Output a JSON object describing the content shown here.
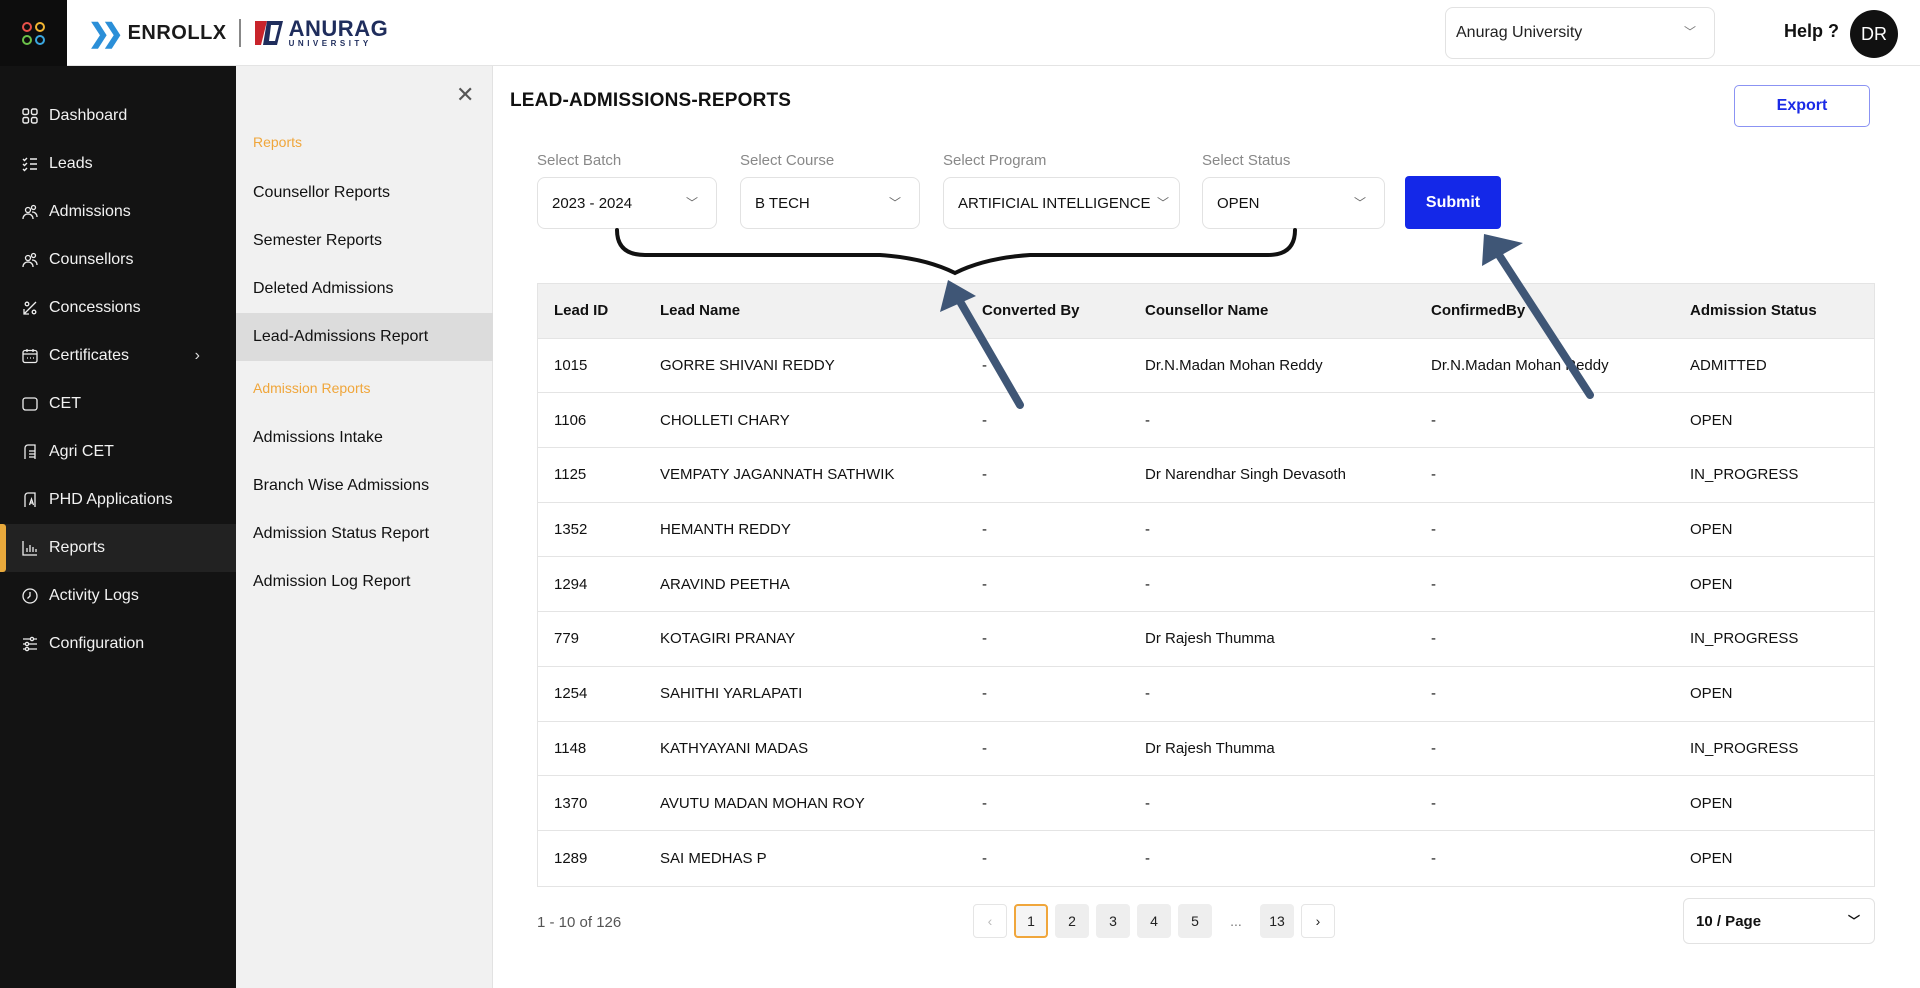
{
  "header": {
    "brand": "ENROLLX",
    "university_logo_main": "ANURAG",
    "university_logo_sub": "UNIVERSITY",
    "org_select_value": "Anurag University",
    "help_label": "Help ?",
    "avatar_initials": "DR",
    "colors": {
      "accent": "#e8a93c",
      "primary": "#1428e8"
    }
  },
  "sidebar": {
    "items": [
      {
        "label": "Dashboard",
        "icon": "grid-icon"
      },
      {
        "label": "Leads",
        "icon": "checklist-icon"
      },
      {
        "label": "Admissions",
        "icon": "users-icon"
      },
      {
        "label": "Counsellors",
        "icon": "users-icon"
      },
      {
        "label": "Concessions",
        "icon": "percent-icon"
      },
      {
        "label": "Certificates",
        "icon": "calendar-icon",
        "has_submenu": true
      },
      {
        "label": "CET",
        "icon": "square-icon"
      },
      {
        "label": "Agri CET",
        "icon": "document-icon"
      },
      {
        "label": "PHD Applications",
        "icon": "application-icon"
      },
      {
        "label": "Reports",
        "icon": "bar-chart-icon",
        "active": true
      },
      {
        "label": "Activity Logs",
        "icon": "clock-icon"
      },
      {
        "label": "Configuration",
        "icon": "sliders-icon"
      }
    ]
  },
  "subnav": {
    "section1": "Reports",
    "section1_items": [
      "Counsellor Reports",
      "Semester Reports",
      "Deleted Admissions",
      "Lead-Admissions Report"
    ],
    "active_item": "Lead-Admissions Report",
    "section2": "Admission Reports",
    "section2_items": [
      "Admissions Intake",
      "Branch Wise Admissions",
      "Admission Status Report",
      "Admission Log Report"
    ]
  },
  "main": {
    "title": "LEAD-ADMISSIONS-REPORTS",
    "export_label": "Export",
    "filters": {
      "batch": {
        "label": "Select Batch",
        "value": "2023 - 2024"
      },
      "course": {
        "label": "Select Course",
        "value": "B TECH"
      },
      "program": {
        "label": "Select Program",
        "value": "ARTIFICIAL INTELLIGENCE"
      },
      "status": {
        "label": "Select Status",
        "value": "OPEN"
      }
    },
    "submit_label": "Submit",
    "table": {
      "columns": [
        "Lead ID",
        "Lead Name",
        "Converted By",
        "Counsellor Name",
        "ConfirmedBy",
        "Admission Status"
      ],
      "rows": [
        [
          "1015",
          "GORRE SHIVANI REDDY",
          "-",
          "Dr.N.Madan Mohan Reddy",
          "Dr.N.Madan Mohan Reddy",
          "ADMITTED"
        ],
        [
          "1106",
          "CHOLLETI CHARY",
          "-",
          "-",
          "-",
          "OPEN"
        ],
        [
          "1125",
          "VEMPATY JAGANNATH SATHWIK",
          "-",
          "Dr Narendhar Singh Devasoth",
          "-",
          "IN_PROGRESS"
        ],
        [
          "1352",
          "HEMANTH REDDY",
          "-",
          "-",
          "-",
          "OPEN"
        ],
        [
          "1294",
          "ARAVIND PEETHA",
          "-",
          "-",
          "-",
          "OPEN"
        ],
        [
          "779",
          "KOTAGIRI PRANAY",
          "-",
          "Dr Rajesh Thumma",
          "-",
          "IN_PROGRESS"
        ],
        [
          "1254",
          "SAHITHI YARLAPATI",
          "-",
          "-",
          "-",
          "OPEN"
        ],
        [
          "1148",
          "KATHYAYANI MADAS",
          "-",
          "Dr Rajesh Thumma",
          "-",
          "IN_PROGRESS"
        ],
        [
          "1370",
          "AVUTU MADAN MOHAN ROY",
          "-",
          "-",
          "-",
          "OPEN"
        ],
        [
          "1289",
          "SAI MEDHAS P",
          "-",
          "-",
          "-",
          "OPEN"
        ]
      ]
    },
    "pagination": {
      "range_text": "1 - 10 of 126",
      "prev": "‹",
      "pages": [
        "1",
        "2",
        "3",
        "4",
        "5"
      ],
      "ellipsis": "...",
      "last_page": "13",
      "next": "›",
      "current_page": 1,
      "page_size": "10 / Page"
    }
  }
}
